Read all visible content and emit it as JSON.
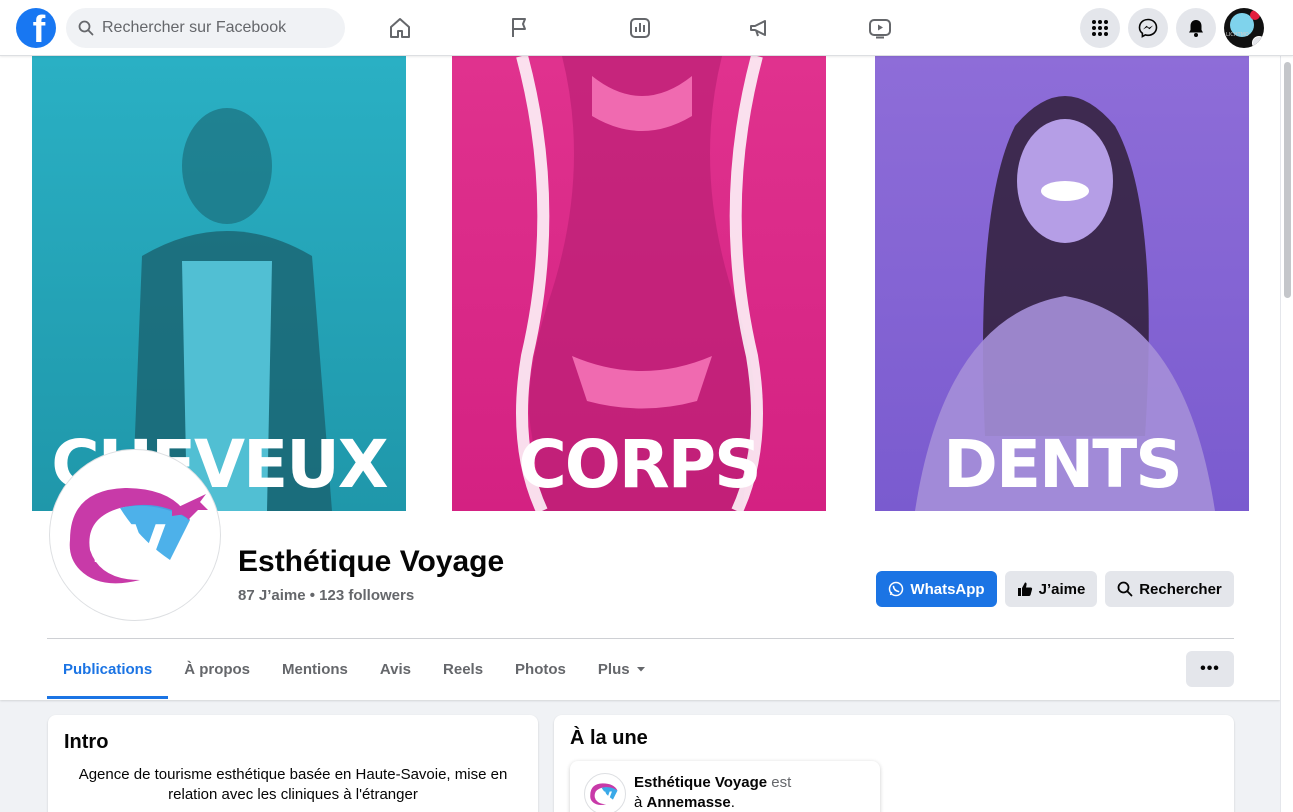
{
  "nav": {
    "search_placeholder": "Rechercher sur Facebook",
    "logo_letter": "f",
    "account_tag": "LICHTMO"
  },
  "cover": {
    "panels": [
      {
        "word": "CHEVEUX",
        "color": "#2ab0c4"
      },
      {
        "word": "CORPS",
        "color": "#e0328e"
      },
      {
        "word": "DENTS",
        "color": "#8e6dd8"
      }
    ]
  },
  "page": {
    "name": "Esthétique Voyage",
    "stats": "87 J’aime • 123 followers"
  },
  "actions": {
    "whatsapp": "WhatsApp",
    "like": "J’aime",
    "search": "Rechercher"
  },
  "tabs": [
    {
      "label": "Publications",
      "active": true
    },
    {
      "label": "À propos"
    },
    {
      "label": "Mentions"
    },
    {
      "label": "Avis"
    },
    {
      "label": "Reels"
    },
    {
      "label": "Photos"
    },
    {
      "label": "Plus"
    }
  ],
  "more_label": "•••",
  "intro": {
    "title": "Intro",
    "text": "Agence de tourisme esthétique basée en Haute-Savoie, mise en relation avec les cliniques à l'étranger"
  },
  "featured": {
    "title": "À la une",
    "post_name": "Esthétique Voyage",
    "post_verb": "est",
    "post_prefix": "à",
    "post_place": "Annemasse",
    "post_end": "."
  },
  "colors": {
    "brand": "#1877f2",
    "accent": "#1b74e4",
    "whatsapp_button": "#1b74e4"
  }
}
